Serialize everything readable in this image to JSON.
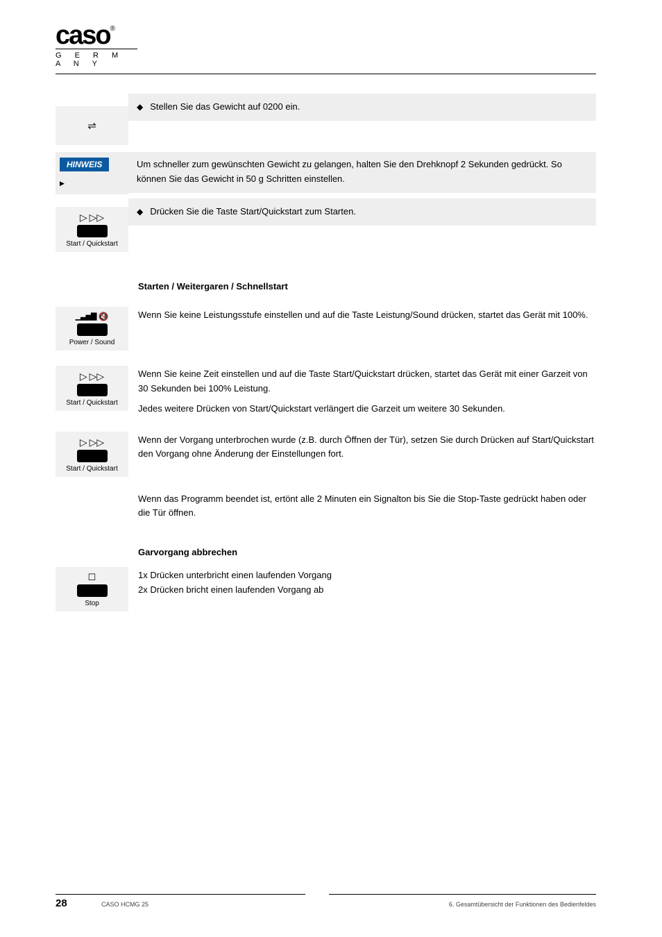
{
  "logo": {
    "brand": "caso",
    "sub": "G E R M A N Y",
    "reg": "®"
  },
  "items": [
    {
      "type": "diamond_pair",
      "icon_name": "weight-icon",
      "icon_glyph": "⚖",
      "right_text": "Stellen Sie das Gewicht auf 0200 ein."
    },
    {
      "type": "note",
      "tag": "HINWEIS",
      "text": "Um schneller zum gewünschten Gewicht zu gelangen, halten Sie den Drehknopf 2 Sekunden gedrückt. So können Sie das Gewicht in 50 g Schritten einstellen."
    },
    {
      "type": "diamond_pair_tile",
      "tile_icon": "play-fwd",
      "tile_label": "Start / Quickstart",
      "right_text": "Drücken Sie die Taste Start/Quickstart zum Starten."
    },
    {
      "type": "heading",
      "text": "Starten / Weitergaren / Schnellstart"
    },
    {
      "type": "tile_desc",
      "tile_icon": "power-sound",
      "tile_label": "Power / Sound",
      "desc": "Wenn Sie keine Leistungsstufe einstellen und auf die Taste Leistung/Sound drücken, startet das Gerät mit 100%."
    },
    {
      "type": "tile_desc_multi",
      "tile_icon": "play-fwd",
      "tile_label": "Start / Quickstart",
      "lines": [
        "Wenn Sie keine Zeit einstellen und auf die Taste Start/Quickstart drücken, startet das Gerät mit einer Garzeit von 30 Sekunden bei 100% Leistung.",
        "Jedes weitere Drücken von Start/Quickstart verlängert die Garzeit um weitere 30 Sekunden."
      ]
    },
    {
      "type": "tile_desc",
      "tile_icon": "play-fwd",
      "tile_label": "Start / Quickstart",
      "desc": "Wenn der Vorgang unterbrochen wurde (z.B. durch Öffnen der Tür), setzen Sie durch Drücken auf Start/Quickstart den Vorgang ohne Änderung der Einstellungen fort."
    },
    {
      "type": "plain",
      "text": "Wenn das Programm beendet ist, ertönt alle 2 Minuten ein Signalton bis Sie die Stop-Taste gedrückt haben oder die Tür öffnen."
    },
    {
      "type": "heading",
      "text": "Garvorgang abbrechen"
    },
    {
      "type": "tile_desc_2l",
      "tile_icon": "stop-square",
      "tile_label": "Stop",
      "lines": [
        "1x Drücken unterbricht einen laufenden Vorgang",
        "2x Drücken bricht einen laufenden Vorgang ab"
      ]
    }
  ],
  "footer": {
    "page": "28",
    "left": "CASO HCMG 25",
    "right": "6. Gesamtübersicht der Funktionen des Bedienfeldes"
  }
}
